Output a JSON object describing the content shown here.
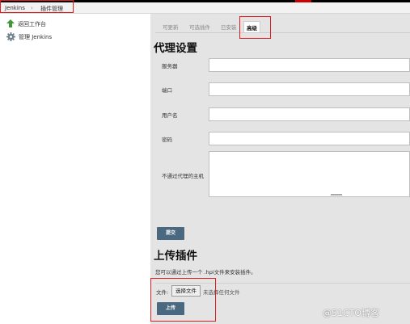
{
  "breadcrumb": {
    "home": "Jenkins",
    "separator": "›",
    "current": "插件管理"
  },
  "sidebar": {
    "items": [
      {
        "label": "返回工作台",
        "icon": "up-arrow-icon"
      },
      {
        "label": "管理 Jenkins",
        "icon": "gear-icon"
      }
    ]
  },
  "tabs": [
    {
      "label": "可更新",
      "active": false
    },
    {
      "label": "可选插件",
      "active": false
    },
    {
      "label": "已安装",
      "active": false
    },
    {
      "label": "高级",
      "active": true
    }
  ],
  "proxy": {
    "title": "代理设置",
    "fields": [
      {
        "label": "服务器",
        "value": ""
      },
      {
        "label": "端口",
        "value": ""
      },
      {
        "label": "用户名",
        "value": ""
      },
      {
        "label": "密码",
        "value": ""
      }
    ],
    "no_proxy_label": "不通过代理的主机",
    "no_proxy_value": "",
    "submit_label": "提交"
  },
  "upload": {
    "title": "上传插件",
    "info": "您可以通过上传一个 .hpi文件来安装插件。",
    "file_label": "文件:",
    "choose_button": "选择文件",
    "no_file_text": "未选择任何文件",
    "submit_label": "上传"
  },
  "watermark": "@51CTO博客",
  "colors": {
    "annotation": "#e02020",
    "button": "#4a6880",
    "panel": "#e4e4e4"
  }
}
